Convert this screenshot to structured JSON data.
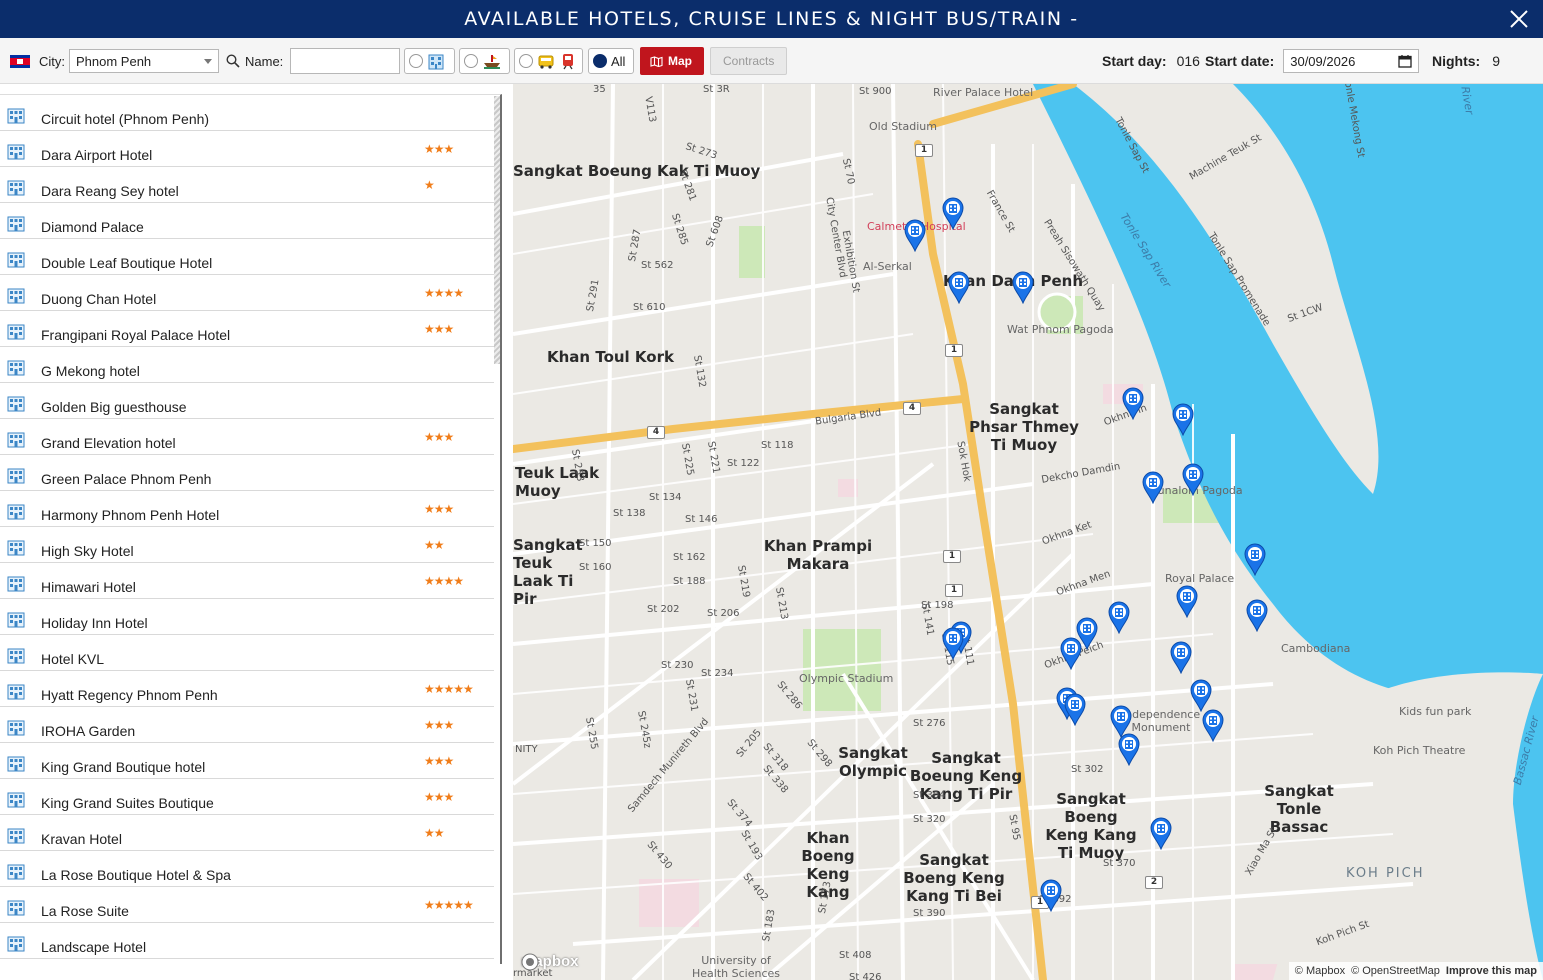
{
  "window": {
    "title": "AVAILABLE HOTELS, CRUISE LINES & NIGHT BUS/TRAIN -"
  },
  "toolbar": {
    "city_label": "City:",
    "city_value": "Phnom Penh",
    "name_label": "Name:",
    "name_value": "",
    "filter_all_label": "All",
    "map_button": "Map",
    "contracts_button": "Contracts",
    "start_day_label": "Start day:",
    "start_day_value": "016",
    "start_date_label": "Start date:",
    "start_date_value": "30/09/2026",
    "nights_label": "Nights:",
    "nights_value": "9"
  },
  "hotels": [
    {
      "name": "Circuit hotel (Phnom Penh)",
      "stars": ""
    },
    {
      "name": "Dara Airport Hotel",
      "stars": "★★★"
    },
    {
      "name": "Dara Reang Sey hotel",
      "stars": "★"
    },
    {
      "name": "Diamond Palace",
      "stars": ""
    },
    {
      "name": "Double Leaf Boutique Hotel",
      "stars": ""
    },
    {
      "name": "Duong Chan Hotel",
      "stars": "★★★★"
    },
    {
      "name": "Frangipani Royal Palace Hotel",
      "stars": "★★★"
    },
    {
      "name": "G Mekong hotel",
      "stars": ""
    },
    {
      "name": "Golden Big guesthouse",
      "stars": ""
    },
    {
      "name": "Grand Elevation hotel",
      "stars": "★★★"
    },
    {
      "name": "Green Palace Phnom Penh",
      "stars": ""
    },
    {
      "name": "Harmony Phnom Penh Hotel",
      "stars": "★★★"
    },
    {
      "name": "High Sky Hotel",
      "stars": "★★"
    },
    {
      "name": "Himawari Hotel",
      "stars": "★★★★"
    },
    {
      "name": "Holiday Inn Hotel",
      "stars": ""
    },
    {
      "name": "Hotel KVL",
      "stars": ""
    },
    {
      "name": "Hyatt Regency Phnom Penh",
      "stars": "★★★★★"
    },
    {
      "name": "IROHA Garden",
      "stars": "★★★"
    },
    {
      "name": "King Grand Boutique hotel",
      "stars": "★★★"
    },
    {
      "name": "King Grand Suites Boutique",
      "stars": "★★★"
    },
    {
      "name": "Kravan Hotel",
      "stars": "★★"
    },
    {
      "name": "La Rose Boutique Hotel & Spa",
      "stars": ""
    },
    {
      "name": "La Rose Suite",
      "stars": "★★★★★"
    },
    {
      "name": "Landscape Hotel",
      "stars": ""
    }
  ],
  "map": {
    "districts": [
      "Sangkat Boeung Kak Ti Muoy",
      "Khan Toul Kork",
      "Khan Daun Penh",
      "Sangkat Phsar Thmey Ti Muoy",
      "Khan Prampi Makara",
      "Sangkat Olympic",
      "Sangkat Boeung Keng Kang Ti Pir",
      "Sangkat Boeng Keng Kang Ti Muoy",
      "Khan Boeng Keng Kang",
      "Sangkat Boeng Keng Kang Ti Bei",
      "Sangkat Tonle Bassac",
      "KOH PICH",
      "Sangkat Teuk Laak Ti Pir",
      "Teuk Laak",
      "Muoy"
    ],
    "pois": [
      "River Palace Hotel",
      "Old Stadium",
      "Calmette Hospital",
      "Al-Serkal",
      "Wat Phnom Pagoda",
      "Ounalom Pagoda",
      "Royal Palace",
      "Cambodiana",
      "Olympic Stadium",
      "Independence Monument",
      "Kids fun park",
      "Koh Pich Theatre",
      "University of Health Sciences",
      "Tonle Sap River",
      "Bassac River",
      "River"
    ],
    "streets": [
      "St 3R",
      "St 900",
      "St 273",
      "St 70",
      "St 281",
      "St 285",
      "St 608",
      "St 287",
      "St 562",
      "St 291",
      "St 610",
      "City Center Blvd",
      "Exhibition St",
      "France St",
      "Preah Sisowath Quay",
      "Tonle Sap St",
      "Machine Teuk St",
      "Tonle Mekong St",
      "Tonle Sap Promenade",
      "St 1CW",
      "St 132",
      "Bulgaria Blvd",
      "St 118",
      "St 122",
      "St 253",
      "St 225",
      "St 221",
      "St 134",
      "St 138",
      "St 146",
      "St 150",
      "St 160",
      "St 162",
      "St 188",
      "St 219",
      "St 202",
      "St 206",
      "St 213",
      "St 230",
      "St 234",
      "Okhna In",
      "Dekcho Damdin",
      "Okhna Ket",
      "Okhna Men",
      "Okhna Peich",
      "Sok Hok",
      "St 198",
      "St 141",
      "St 115",
      "St 111",
      "St 286",
      "St 231",
      "St 245z",
      "St 255",
      "Samdech Munireth Blvd",
      "St 205",
      "St 318",
      "St 298",
      "St 338",
      "St 276",
      "St 302",
      "St 304",
      "St 320",
      "St 95",
      "St 374",
      "St 193",
      "St 430",
      "St 402",
      "St 173",
      "St 183",
      "St 370",
      "St 392",
      "St 390",
      "St 408",
      "St 426",
      "Xiao Ma St",
      "Koh Pich St",
      "NITY",
      "35",
      "V113",
      "rmarket"
    ],
    "road_shields": [
      "1",
      "1",
      "1",
      "4",
      "4",
      "1",
      "2",
      "1"
    ],
    "attribution": {
      "mapbox": "© Mapbox",
      "osm": "© OpenStreetMap",
      "improve": "Improve this map"
    },
    "logo": "mapbox"
  },
  "colors": {
    "titlebar": "#0b2d6b",
    "map_button": "#c0151d",
    "stars": "#f07d1a",
    "river": "#4cc4f0",
    "pin": "#1a73e8",
    "major_road": "#f3c15c"
  }
}
